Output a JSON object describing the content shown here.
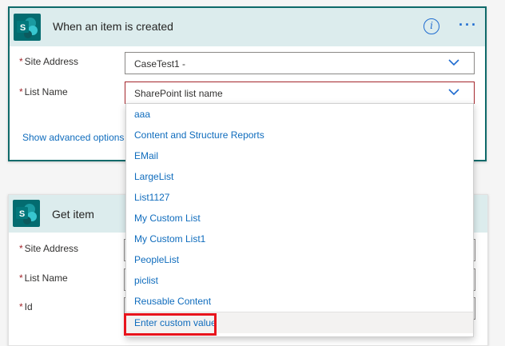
{
  "trigger_card": {
    "title": "When an item is created",
    "info_glyph": "i",
    "more_glyph": "···",
    "site_address": {
      "label": "Site Address",
      "value": "CaseTest1 -"
    },
    "list_name": {
      "label": "List Name",
      "placeholder": "SharePoint list name"
    },
    "advanced_link": "Show advanced options"
  },
  "action_card": {
    "title": "Get item",
    "fields": [
      {
        "label": "Site Address"
      },
      {
        "label": "List Name"
      },
      {
        "label": "Id"
      }
    ]
  },
  "required_marker": "*",
  "dropdown": {
    "items": [
      "aaa",
      "Content and Structure Reports",
      "EMail",
      "LargeList",
      "List1127",
      "My Custom List",
      "My Custom List1",
      "PeopleList",
      "piclist",
      "Reusable Content"
    ],
    "custom_value": "Enter custom value"
  },
  "colors": {
    "accent": "#1f6cd0",
    "link": "#0f6cbd",
    "header_bg": "#dceced",
    "sharepoint": "#036c70",
    "highlight": "#e8141c",
    "required": "#a4262c"
  },
  "icons": [
    "sharepoint-icon",
    "info-icon",
    "more-icon",
    "chevron-down-icon"
  ]
}
